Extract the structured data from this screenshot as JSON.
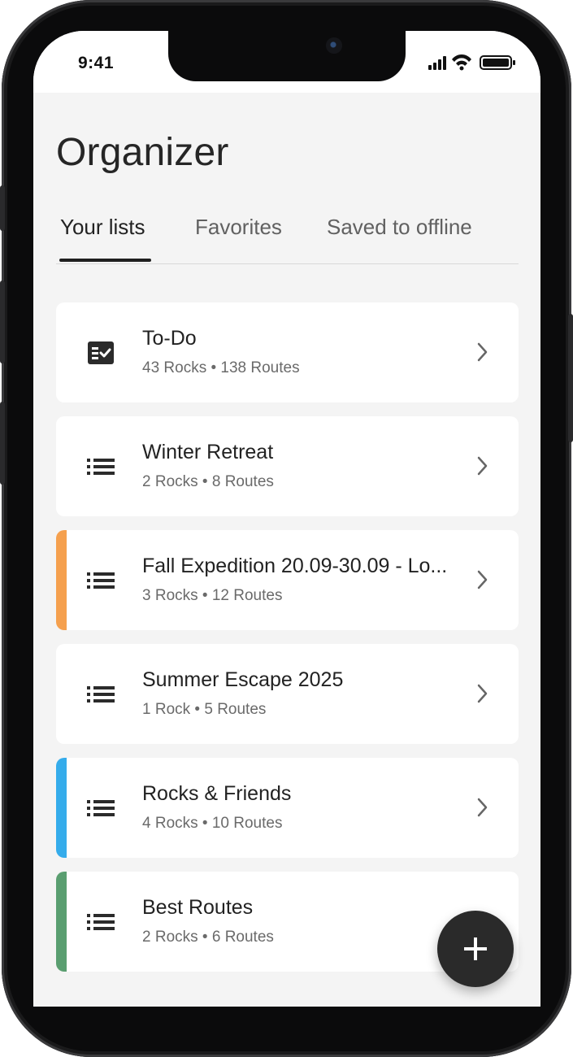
{
  "status_bar": {
    "time": "9:41",
    "icons": [
      "cellular-signal-icon",
      "wifi-icon",
      "battery-icon"
    ]
  },
  "page": {
    "title": "Organizer"
  },
  "tabs": [
    {
      "label": "Your lists",
      "active": true
    },
    {
      "label": "Favorites",
      "active": false
    },
    {
      "label": "Saved to offline",
      "active": false
    }
  ],
  "lists": [
    {
      "title": "To-Do",
      "meta": "43 Rocks • 138 Routes",
      "icon": "checklist-icon",
      "accent": null
    },
    {
      "title": "Winter Retreat",
      "meta": "2 Rocks • 8 Routes",
      "icon": "list-icon",
      "accent": null
    },
    {
      "title": "Fall Expedition 20.09-30.09 - Lo...",
      "meta": "3 Rocks • 12 Routes",
      "icon": "list-icon",
      "accent": "#F5A04E"
    },
    {
      "title": "Summer Escape 2025",
      "meta": "1 Rock • 5 Routes",
      "icon": "list-icon",
      "accent": null
    },
    {
      "title": "Rocks & Friends",
      "meta": "4 Rocks • 10 Routes",
      "icon": "list-icon",
      "accent": "#35ACEB"
    },
    {
      "title": "Best Routes",
      "meta": "2 Rocks • 6 Routes",
      "icon": "list-icon",
      "accent": "#5A9E70"
    }
  ],
  "fab": {
    "icon": "plus-icon"
  },
  "colors": {
    "text_primary": "#222222",
    "text_secondary": "#6A6A6A",
    "background": "#F4F4F4",
    "fab": "#2A2A2A"
  }
}
